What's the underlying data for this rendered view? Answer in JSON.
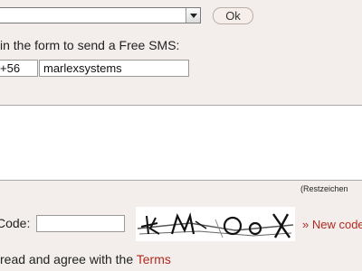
{
  "top": {
    "select_value": "",
    "ok_label": "Ok"
  },
  "form": {
    "intro": "in the form to send a Free SMS:",
    "prefix": "+56",
    "phone": "marlexsystems",
    "message": "",
    "remaining_label": "(Restzeichen"
  },
  "captcha": {
    "code_label": "Code:",
    "code_value": "",
    "image_text": "KM OoX",
    "new_code_link": "» New code"
  },
  "terms": {
    "text_before": "read and agree with the ",
    "link": "Terms"
  },
  "icons": {
    "select_arrow": "chevron-down-icon"
  }
}
